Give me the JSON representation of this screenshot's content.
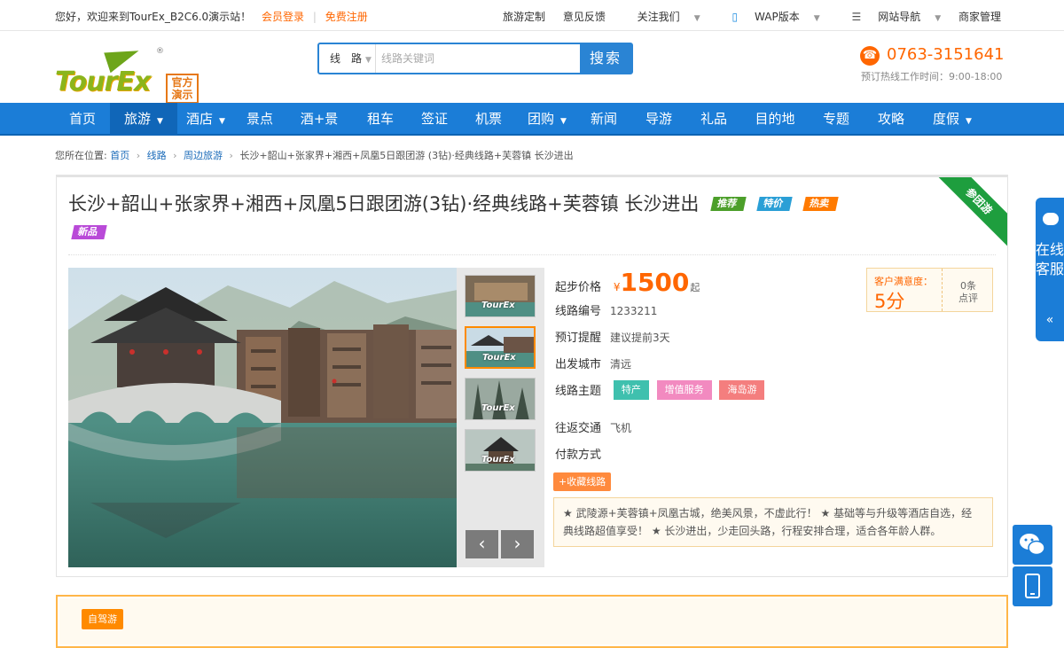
{
  "topbar": {
    "welcome": "您好，欢迎来到TourEx_B2C6.0演示站！",
    "login": "会员登录",
    "register": "免费注册",
    "links": [
      "旅游定制",
      "意见反馈",
      "关注我们",
      "WAP版本",
      "网站导航",
      "商家管理"
    ]
  },
  "logo": {
    "text": "TourEx",
    "badge_line1": "官方",
    "badge_line2": "演示",
    "reg": "®"
  },
  "search": {
    "category": "线　路",
    "placeholder": "线路关键词",
    "button": "搜索"
  },
  "hotline": {
    "phone": "0763-3151641",
    "hours": "预订热线工作时间：9:00-18:00"
  },
  "nav": [
    "首页",
    "旅游",
    "酒店",
    "景点",
    "酒+景",
    "租车",
    "签证",
    "机票",
    "团购",
    "新闻",
    "导游",
    "礼品",
    "目的地",
    "专题",
    "攻略",
    "度假"
  ],
  "breadcrumb": {
    "prefix": "您所在位置:",
    "home": "首页",
    "route": "线路",
    "nearby": "周边旅游",
    "current": "长沙+韶山+张家界+湘西+凤凰5日跟团游 (3钻)·经典线路+芙蓉镇 长沙进出"
  },
  "product": {
    "title": "长沙+韶山+张家界+湘西+凤凰5日跟团游(3钻)·经典线路+芙蓉镇 长沙进出",
    "tags": {
      "recommend": "推荐",
      "special": "特价",
      "hot": "热卖",
      "new": "新品"
    },
    "ribbon": "参团游",
    "thumb_watermark": "TourEx",
    "price_label": "起步价格",
    "currency": "¥",
    "price": "1500",
    "price_unit": "起",
    "code_label": "线路编号",
    "code": "1233211",
    "remind_label": "预订提醒",
    "remind": "建议提前3天",
    "city_label": "出发城市",
    "city": "清远",
    "theme_label": "线路主题",
    "themes": [
      "特产",
      "增值服务",
      "海岛游"
    ],
    "traffic_label": "往返交通",
    "traffic": "飞机",
    "pay_label": "付款方式",
    "pay": "",
    "fav_button": "+收藏线路",
    "desc_line1": "★ 武陵源+芙蓉镇+凤凰古城，绝美风景，不虚此行！ ★ 基础等与升级等酒店自选，经",
    "desc_line2": "典线路超值享受！ ★ 长沙进出，少走回头路，行程安排合理，适合各年龄人群。",
    "satisfaction_label": "客户满意度：",
    "satisfaction": "5分",
    "reviews_count": "0条",
    "reviews_label": "点评"
  },
  "tab2": {
    "badge": "自驾游"
  },
  "side": {
    "chat_text": "在线客服",
    "chevron": "«"
  },
  "colors": {
    "brand_blue": "#1b7dd7",
    "orange": "#ff6600",
    "green_ribbon": "#1e9e3e"
  }
}
